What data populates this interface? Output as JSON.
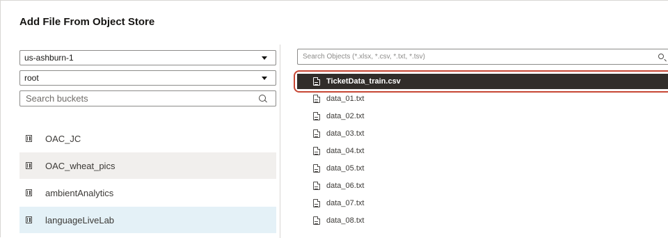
{
  "dialog": {
    "title": "Add File From Object Store"
  },
  "left": {
    "region_select": {
      "value": "us-ashburn-1",
      "icon": "caret-down-icon"
    },
    "compartment_select": {
      "value": "root",
      "icon": "caret-down-icon"
    },
    "bucket_search": {
      "placeholder": "Search buckets",
      "icon": "search-icon"
    },
    "buckets": [
      {
        "label": "OAC_JC",
        "state": "normal",
        "icon": "bucket-icon"
      },
      {
        "label": "OAC_wheat_pics",
        "state": "shaded",
        "icon": "bucket-icon"
      },
      {
        "label": "ambientAnalytics",
        "state": "normal",
        "icon": "bucket-icon"
      },
      {
        "label": "languageLiveLab",
        "state": "selected",
        "icon": "bucket-icon"
      }
    ]
  },
  "right": {
    "object_search": {
      "placeholder": "Search Objects (*.xlsx, *.csv, *.txt, *.tsv)",
      "icon": "search-icon"
    },
    "files": [
      {
        "name": "TicketData_train.csv",
        "state": "selected",
        "icon": "csv-file-icon"
      },
      {
        "name": "data_01.txt",
        "state": "normal",
        "icon": "csv-file-icon"
      },
      {
        "name": "data_02.txt",
        "state": "normal",
        "icon": "csv-file-icon"
      },
      {
        "name": "data_03.txt",
        "state": "normal",
        "icon": "csv-file-icon"
      },
      {
        "name": "data_04.txt",
        "state": "normal",
        "icon": "csv-file-icon"
      },
      {
        "name": "data_05.txt",
        "state": "normal",
        "icon": "csv-file-icon"
      },
      {
        "name": "data_06.txt",
        "state": "normal",
        "icon": "csv-file-icon"
      },
      {
        "name": "data_07.txt",
        "state": "normal",
        "icon": "csv-file-icon"
      },
      {
        "name": "data_08.txt",
        "state": "normal",
        "icon": "csv-file-icon"
      }
    ]
  },
  "colors": {
    "selected_file_bg": "#312d2a",
    "highlight_ring": "#c74634",
    "selected_bucket_bg": "#e4f1f7",
    "shaded_bucket_bg": "#f1efed"
  }
}
